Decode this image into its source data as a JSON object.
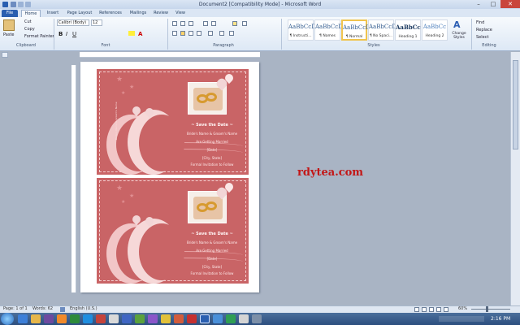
{
  "window": {
    "title": "Document2 [Compatibility Mode]  -  Microsoft Word",
    "controls": [
      "–",
      "□",
      "✕"
    ]
  },
  "tabs": [
    "File",
    "Home",
    "Insert",
    "Page Layout",
    "References",
    "Mailings",
    "Review",
    "View"
  ],
  "ribbon": {
    "clipboard": {
      "label": "Clipboard",
      "paste": "Paste",
      "cut": "Cut",
      "copy": "Copy",
      "format_painter": "Format Painter"
    },
    "font": {
      "label": "Font",
      "name": "Calibri (Body)",
      "size": "12"
    },
    "paragraph": {
      "label": "Paragraph"
    },
    "styles": {
      "label": "Styles",
      "items": [
        {
          "preview": "AaBbCcD",
          "name": "¶ Instructi..."
        },
        {
          "preview": "AaBbCcD",
          "name": "¶ Names"
        },
        {
          "preview": "AaBbCcD",
          "name": "¶ Normal"
        },
        {
          "preview": "AaBbCcD",
          "name": "¶ No Spaci..."
        },
        {
          "preview": "AaBbCc",
          "name": "Heading 1"
        },
        {
          "preview": "AaBbCc",
          "name": "Heading 2"
        }
      ],
      "change_styles": "Change Styles"
    },
    "editing": {
      "label": "Editing",
      "find": "Find",
      "replace": "Replace",
      "select": "Select"
    }
  },
  "document": {
    "cards": [
      {
        "title": "~ Save the Date ~",
        "names": "Bride's Name & Groom's Name",
        "line": "Are Getting Married",
        "date": "[Date]",
        "place": "[City, State]",
        "follow": "Formal Invitation to Follow"
      },
      {
        "title": "~ Save the Date ~",
        "names": "Bride's Name & Groom's Name",
        "line": "Are Getting Married",
        "date": "[Date]",
        "place": "[City, State]",
        "follow": "Formal Invitation to Follow"
      }
    ],
    "watermark": "rdytea.com"
  },
  "status": {
    "page": "Page: 1 of 1",
    "words": "Words: 62",
    "language": "English (U.S.)",
    "zoom": "60%"
  },
  "taskbar": {
    "clock": "2:16 PM"
  },
  "colors": {
    "card": "#c96466",
    "file_tab": "#2a5fb0",
    "watermark": "#c31616"
  }
}
